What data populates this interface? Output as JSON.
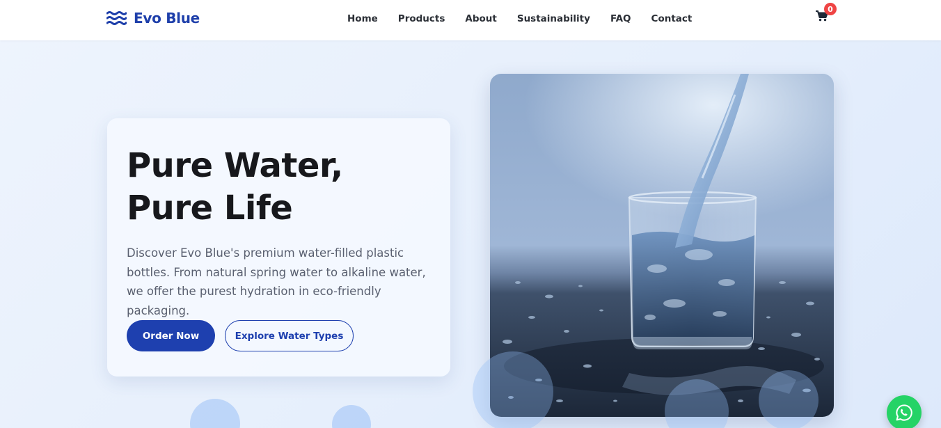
{
  "brand": {
    "name": "Evo Blue",
    "icon": "water-waves-icon",
    "color": "#1e3faa"
  },
  "nav": {
    "items": [
      {
        "label": "Home"
      },
      {
        "label": "Products"
      },
      {
        "label": "About"
      },
      {
        "label": "Sustainability"
      },
      {
        "label": "FAQ"
      },
      {
        "label": "Contact"
      }
    ]
  },
  "cart": {
    "icon": "cart-icon",
    "count": "0"
  },
  "hero": {
    "title": "Pure Water, Pure Life",
    "description": "Discover Evo Blue's premium water-filled plastic bottles. From natural spring water to alkaline water, we offer the purest hydration in eco-friendly packaging.",
    "primary_button": "Order Now",
    "secondary_button": "Explore Water Types",
    "image_subject": "water-pouring-into-glass"
  },
  "whatsapp": {
    "icon": "whatsapp-icon"
  },
  "colors": {
    "accent": "#1e40af",
    "badge": "#ef4444",
    "whatsapp": "#25d366",
    "background": "#e6effc"
  }
}
